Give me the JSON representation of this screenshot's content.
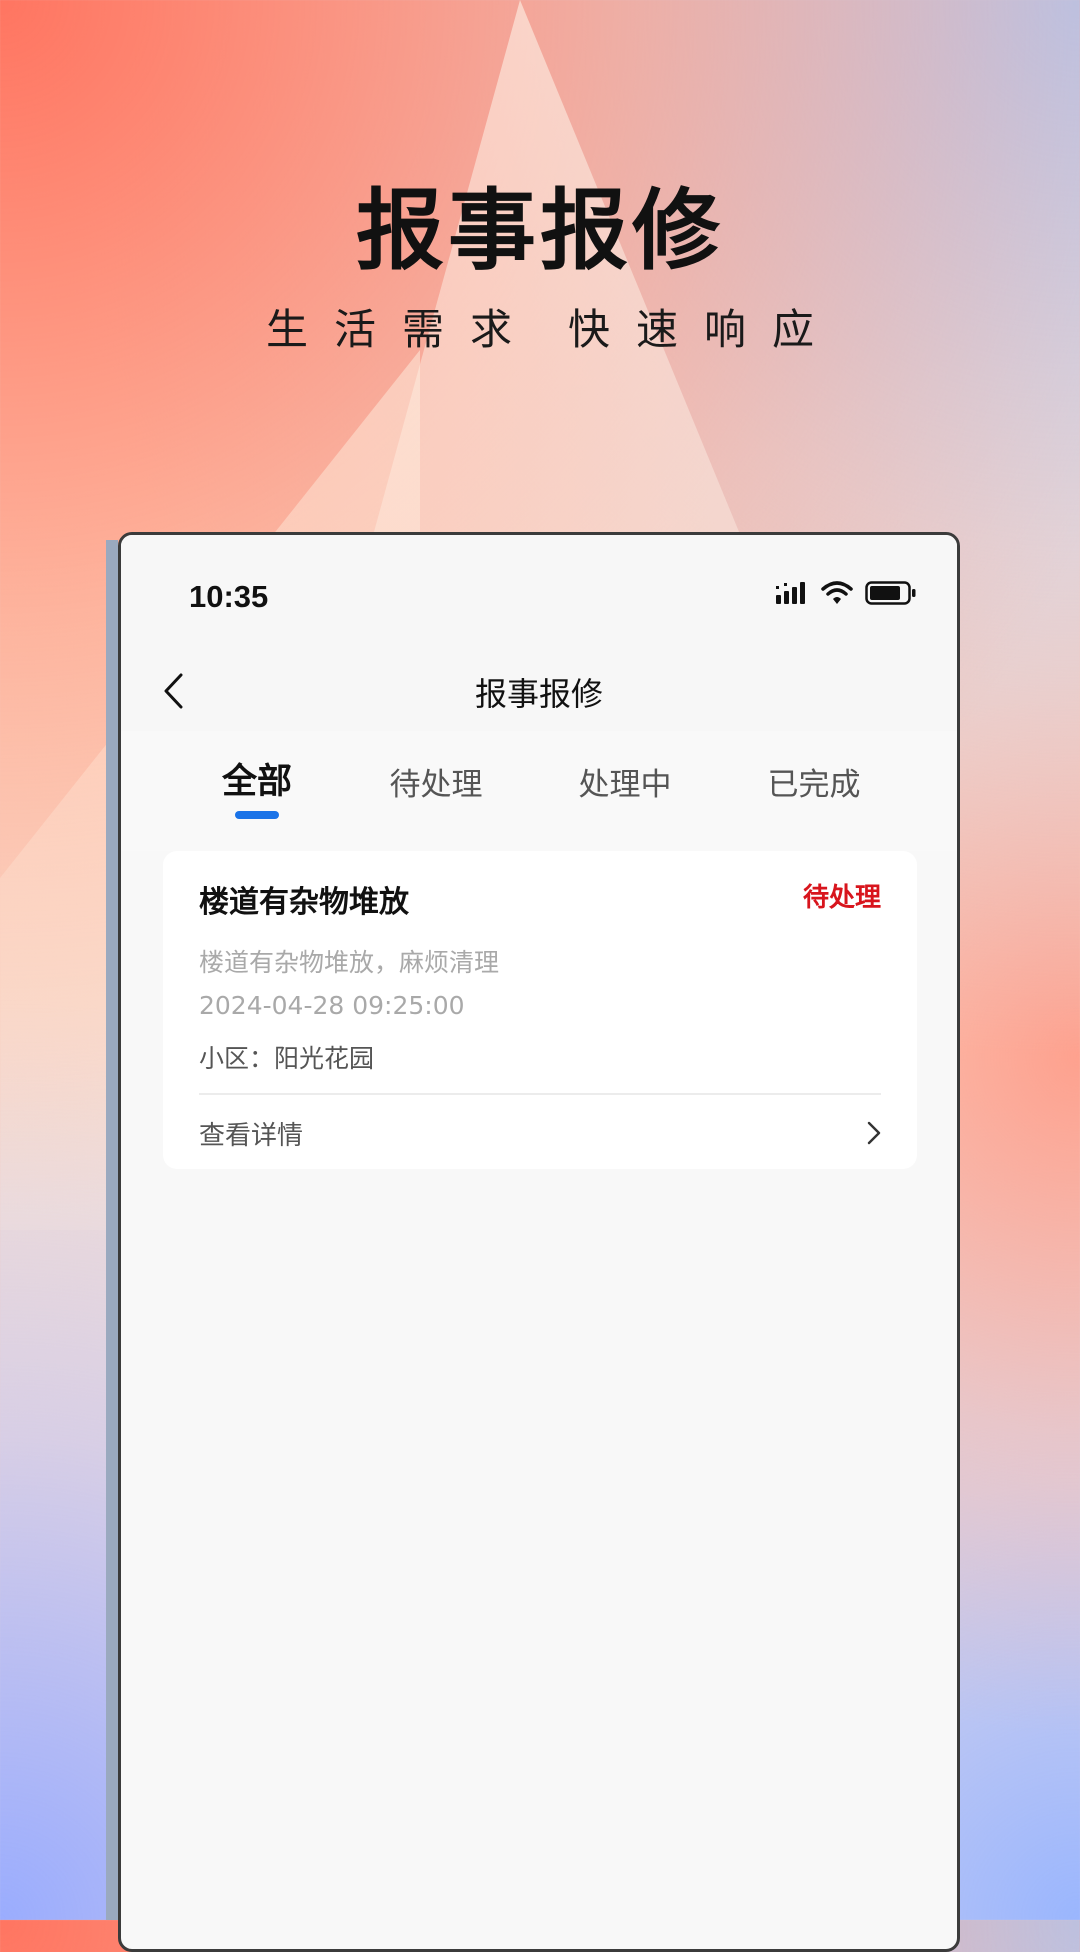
{
  "hero": {
    "title": "报事报修",
    "subtitle_left": "生活需求",
    "subtitle_right": "快速响应"
  },
  "phone": {
    "status_bar": {
      "time": "10:35",
      "icons": [
        "signal-icon",
        "wifi-icon",
        "battery-icon"
      ]
    },
    "navbar": {
      "back_icon": "chevron-left-icon",
      "title": "报事报修"
    },
    "tabs": [
      {
        "label": "全部",
        "active": true
      },
      {
        "label": "待处理",
        "active": false
      },
      {
        "label": "处理中",
        "active": false
      },
      {
        "label": "已完成",
        "active": false
      }
    ],
    "records": [
      {
        "title": "楼道有杂物堆放",
        "status": "待处理",
        "description": "楼道有杂物堆放，麻烦清理",
        "time": "2024-04-28 09:25:00",
        "community_label": "小区：",
        "community": "阳光花园",
        "detail_label": "查看详情"
      }
    ]
  },
  "colors": {
    "accent": "#1a73e8",
    "status_pending": "#d8151d"
  }
}
